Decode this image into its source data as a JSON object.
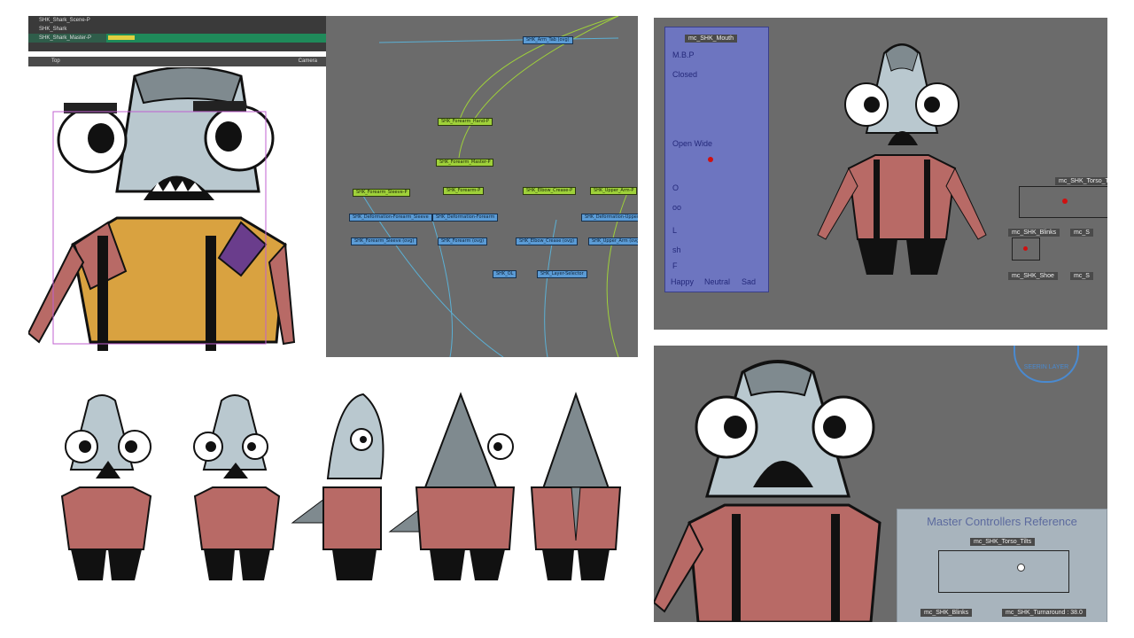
{
  "timeline": {
    "layers": [
      "SHK_Shark_Scene-P",
      "SHK_Shark",
      "SHK_Shark_Master-P"
    ]
  },
  "camera_view": {
    "tab_top": "Top",
    "tab_camera": "Camera"
  },
  "node_view": {
    "nodes_green": [
      "SHK_Forearm_Hand-P",
      "SHK_Forearm_Master-P",
      "SHK_Forearm_Sleeve-P",
      "SHK_Forearm-P",
      "SHK_Elbow_Crease-P",
      "SHK_Upper_Arm-P"
    ],
    "nodes_blue": [
      "SHK_Arm_Tab (ovg)",
      "SHK_Deformation-Forearm_Sleeve",
      "SHK_Deformation-Forearm",
      "SHK_Deformation-Upper_Arm",
      "SHK_Forearm_Sleeve (ovg)",
      "SHK_Forearm (ovg)",
      "SHK_Elbow_Crease (ovg)",
      "SHK_Upper_Arm (ovg)",
      "SHK_OL",
      "SHK_Layer-Selector"
    ]
  },
  "mouth_controller": {
    "title": "mc_SHK_Mouth",
    "rows": [
      "M.B.P",
      "Closed",
      "Open Wide",
      "O",
      "oo",
      "L",
      "sh",
      "F"
    ],
    "columns": [
      "Happy",
      "Neutral",
      "Sad"
    ]
  },
  "side_controllers": {
    "torso": "mc_SHK_Torso_Ti",
    "blinks": "mc_SHK_Blinks",
    "shoe": "mc_SHK_Shoe",
    "extra_a": "mc_S",
    "extra_b": "mc_S"
  },
  "reference": {
    "title": "Master Controllers Reference",
    "torso_tilts": "mc_SHK_Torso_Tilts",
    "blinks": "mc_SHK_Blinks",
    "turnaround": "mc_SHK_Turnaround : 38.0",
    "logo_text": "SEERIN LAYER"
  },
  "colors": {
    "shirt": "#b86a66",
    "shirt_yellow": "#d9a240",
    "shirt_sleeve_purple": "#6a3d8c",
    "skin": "#b9c8cf",
    "fin": "#7f8a8f",
    "pants": "#111111",
    "node_green": "#9fd13a",
    "node_blue": "#5b9bd5",
    "mouth_panel": "#6e78dc",
    "ui_gray": "#6b6b6b"
  }
}
